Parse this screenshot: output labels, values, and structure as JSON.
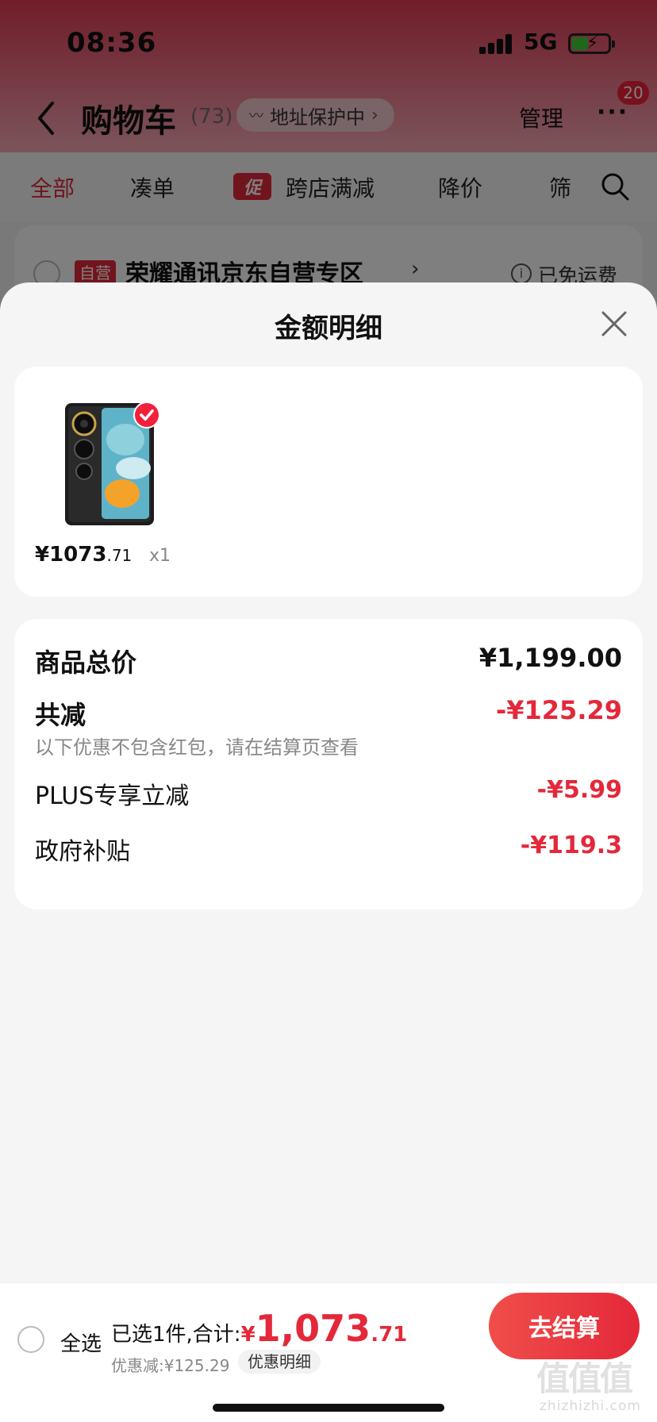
{
  "status_bar": {
    "time": "08:36",
    "network": "5G"
  },
  "nav": {
    "title": "购物车",
    "count": "(73)",
    "address_pill": "地址保护中",
    "manage": "管理",
    "more_badge": "20"
  },
  "tabs": {
    "all": "全部",
    "bundle": "凑单",
    "promo_tag": "促",
    "cross_store": "跨店满减",
    "price_drop": "降价",
    "filter": "筛"
  },
  "store": {
    "self_tag": "自营",
    "name": "荣耀通讯京东自营专区",
    "shipping": "已免运费"
  },
  "sheet": {
    "title": "金额明细",
    "product": {
      "price_symbol": "¥",
      "price_int": "1073",
      "price_dec": ".71",
      "quantity": "x1"
    },
    "rows": {
      "total_label": "商品总价",
      "total_value": "¥1,199.00",
      "reduce_label": "共减",
      "reduce_value": "-¥125.29",
      "note": "以下优惠不包含红包，请在结算页查看",
      "plus_label": "PLUS专享立减",
      "plus_value": "-¥5.99",
      "gov_label": "政府补贴",
      "gov_value": "-¥119.3"
    }
  },
  "action_bar": {
    "select_all": "全选",
    "summary_label": "已选1件,合计:",
    "total_yen": "¥",
    "total_int": "1,073",
    "total_dec": ".71",
    "discount_text": "优惠减:¥125.29",
    "detail_pill": "优惠明细",
    "checkout": "去结算"
  },
  "watermark": {
    "domain": "zhizhizhi.com",
    "glyphs": "值值值"
  },
  "colors": {
    "accent_red": "#e4283a",
    "header_pink": "#e23b53"
  }
}
